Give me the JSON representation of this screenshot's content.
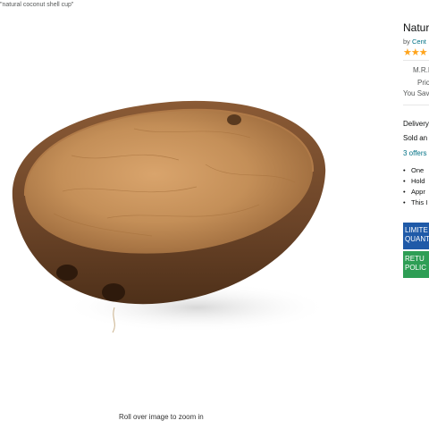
{
  "breadcrumb": "\"natural coconut shell cup\"",
  "image": {
    "zoom_hint": "Roll over image to zoom in"
  },
  "product": {
    "title": "Natur",
    "brand_prefix": "by",
    "brand": "Cent",
    "stars": "★★★",
    "mrp_label": "M.R.I",
    "price_label": "Pric",
    "save_label": "You Sav",
    "delivery": "Delivery",
    "sold_by": "Sold an",
    "offers": "3 offers",
    "bullets": [
      "One",
      "Hold",
      "Appr",
      "This I"
    ],
    "badge_limited": [
      "LIMITE",
      "QUANT"
    ],
    "badge_return": [
      "RETU",
      "POLIC"
    ]
  },
  "colors": {
    "link": "#007185",
    "star": "#ffa41c",
    "badge_limited": "#1f5aa8",
    "badge_return": "#2e9e55"
  }
}
